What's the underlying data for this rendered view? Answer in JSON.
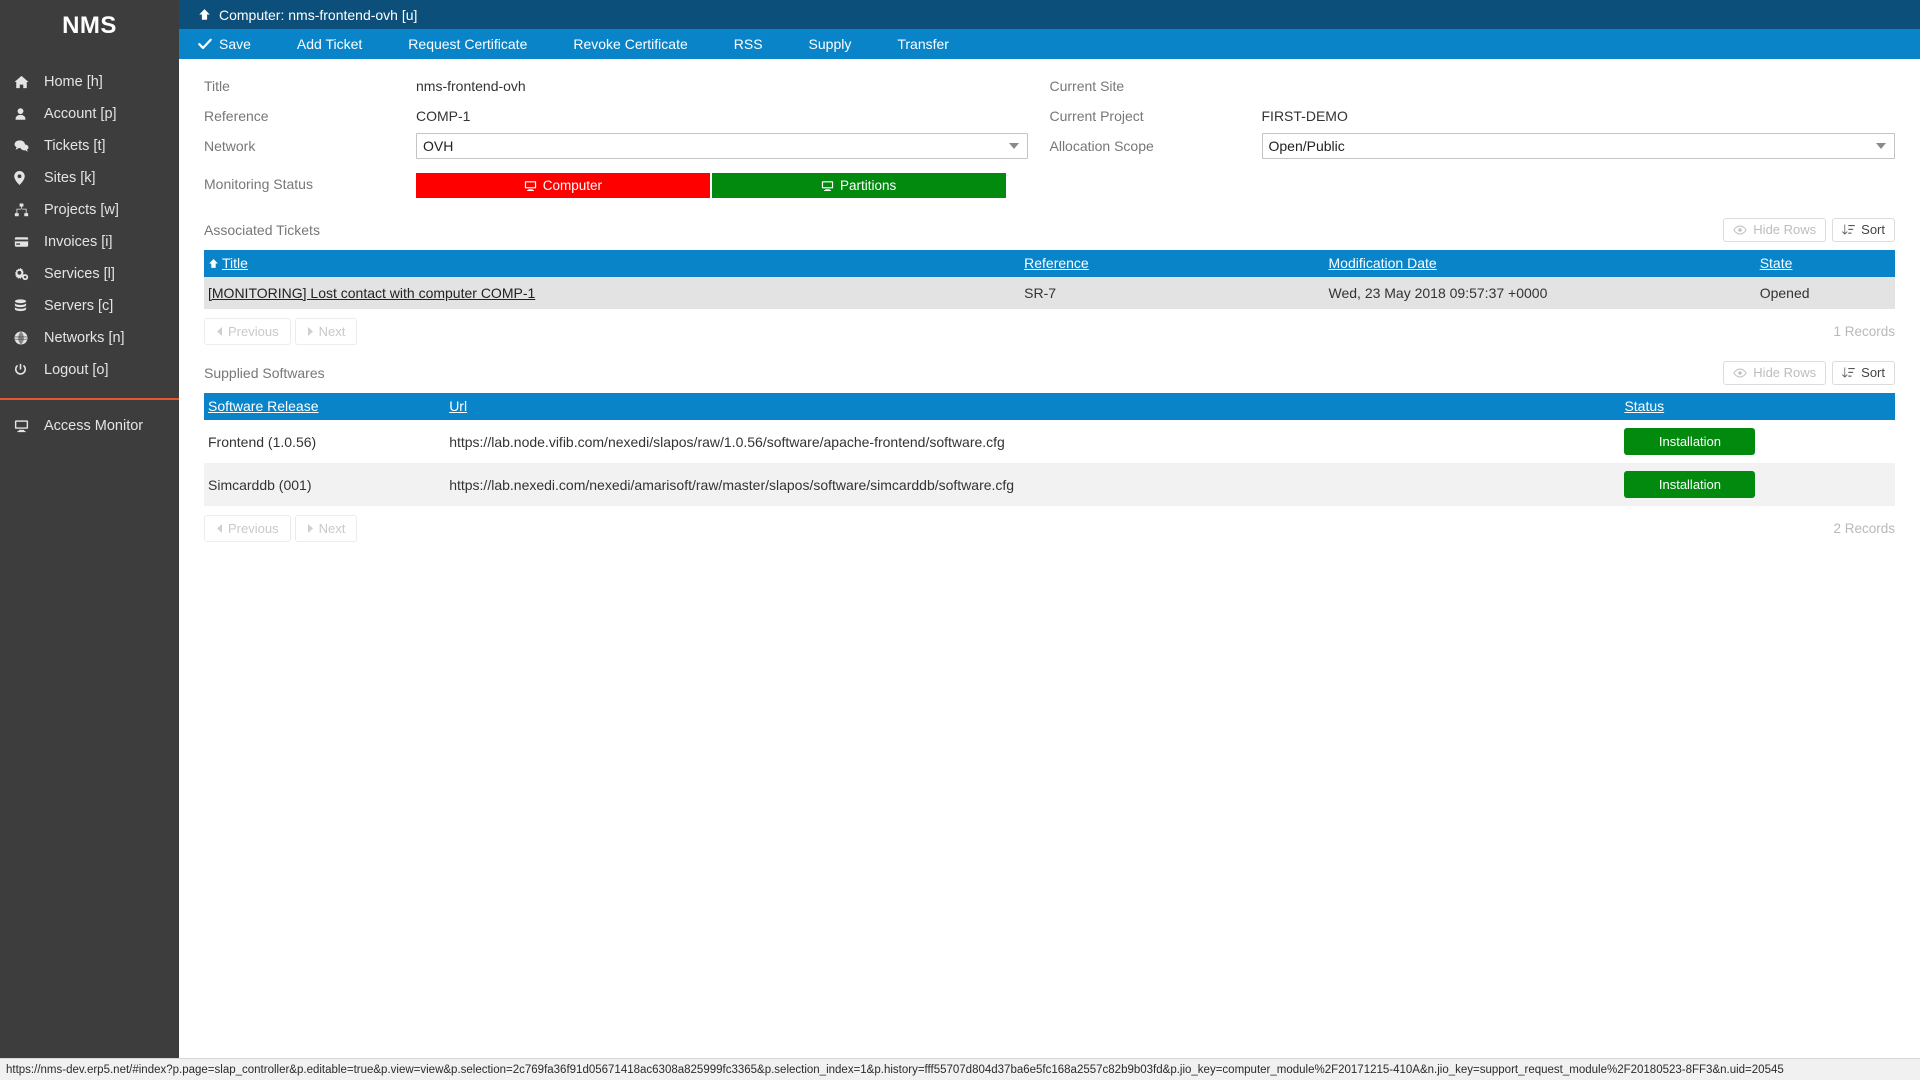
{
  "sidebar": {
    "brand": "NMS",
    "items": [
      {
        "label": "Home [h]",
        "icon": "home-icon"
      },
      {
        "label": "Account [p]",
        "icon": "user-icon"
      },
      {
        "label": "Tickets [t]",
        "icon": "comments-icon"
      },
      {
        "label": "Sites [k]",
        "icon": "map-marker-icon"
      },
      {
        "label": "Projects [w]",
        "icon": "sitemap-icon"
      },
      {
        "label": "Invoices [i]",
        "icon": "credit-card-icon"
      },
      {
        "label": "Services [l]",
        "icon": "cogs-icon"
      },
      {
        "label": "Servers [c]",
        "icon": "database-icon"
      },
      {
        "label": "Networks [n]",
        "icon": "globe-icon"
      },
      {
        "label": "Logout [o]",
        "icon": "power-icon"
      }
    ],
    "footer_items": [
      {
        "label": "Access Monitor",
        "icon": "desktop-icon"
      }
    ]
  },
  "titlebar": {
    "title": "Computer: nms-frontend-ovh [u]",
    "up_icon": "arrow-up-icon"
  },
  "toolbar": {
    "items": [
      {
        "label": "Save",
        "icon": "check-icon"
      },
      {
        "label": "Add Ticket",
        "icon": ""
      },
      {
        "label": "Request Certificate",
        "icon": ""
      },
      {
        "label": "Revoke Certificate",
        "icon": ""
      },
      {
        "label": "RSS",
        "icon": ""
      },
      {
        "label": "Supply",
        "icon": ""
      },
      {
        "label": "Transfer",
        "icon": ""
      }
    ]
  },
  "form": {
    "left": {
      "title_label": "Title",
      "title_value": "nms-frontend-ovh",
      "reference_label": "Reference",
      "reference_value": "COMP-1",
      "network_label": "Network",
      "network_value": "OVH",
      "monitoring_label": "Monitoring Status",
      "monitoring_buttons": [
        {
          "label": "Computer",
          "color": "#ff0000",
          "icon": "desktop-icon"
        },
        {
          "label": "Partitions",
          "color": "#028a0f",
          "icon": "desktop-icon"
        }
      ]
    },
    "right": {
      "current_site_label": "Current Site",
      "current_site_value": "",
      "current_project_label": "Current Project",
      "current_project_value": "FIRST-DEMO",
      "allocation_scope_label": "Allocation Scope",
      "allocation_scope_value": "Open/Public"
    }
  },
  "associated_tickets": {
    "section_title": "Associated Tickets",
    "hide_rows_label": "Hide Rows",
    "sort_label": "Sort",
    "columns": [
      "Title",
      "Reference",
      "Modification Date",
      "State"
    ],
    "sorted_column": "Title",
    "rows": [
      {
        "title": "[MONITORING] Lost contact with computer COMP-1",
        "reference": "SR-7",
        "modification_date": "Wed, 23 May 2018 09:57:37 +0000",
        "state": "Opened"
      }
    ],
    "previous_label": "Previous",
    "next_label": "Next",
    "records": "1 Records"
  },
  "supplied_softwares": {
    "section_title": "Supplied Softwares",
    "hide_rows_label": "Hide Rows",
    "sort_label": "Sort",
    "columns": [
      "Software Release",
      "Url",
      "Status"
    ],
    "rows": [
      {
        "software_release": "Frontend (1.0.56)",
        "url": "https://lab.node.vifib.com/nexedi/slapos/raw/1.0.56/software/apache-frontend/software.cfg",
        "status": "Installation"
      },
      {
        "software_release": "Simcarddb (001)",
        "url": "https://lab.nexedi.com/nexedi/amarisoft/raw/master/slapos/software/simcarddb/software.cfg",
        "status": "Installation"
      }
    ],
    "previous_label": "Previous",
    "next_label": "Next",
    "records": "2 Records"
  },
  "statusbar": {
    "url": "https://nms-dev.erp5.net/#index?p.page=slap_controller&p.editable=true&p.view=view&p.selection=2c769fa36f91d05671418ac6308a825999fc3365&p.selection_index=1&p.history=fff55707d804d37ba6e5fc168a2557c82b9b03fd&p.jio_key=computer_module%2F20171215-410A&n.jio_key=support_request_module%2F20180523-8FF3&n.uid=20545"
  }
}
